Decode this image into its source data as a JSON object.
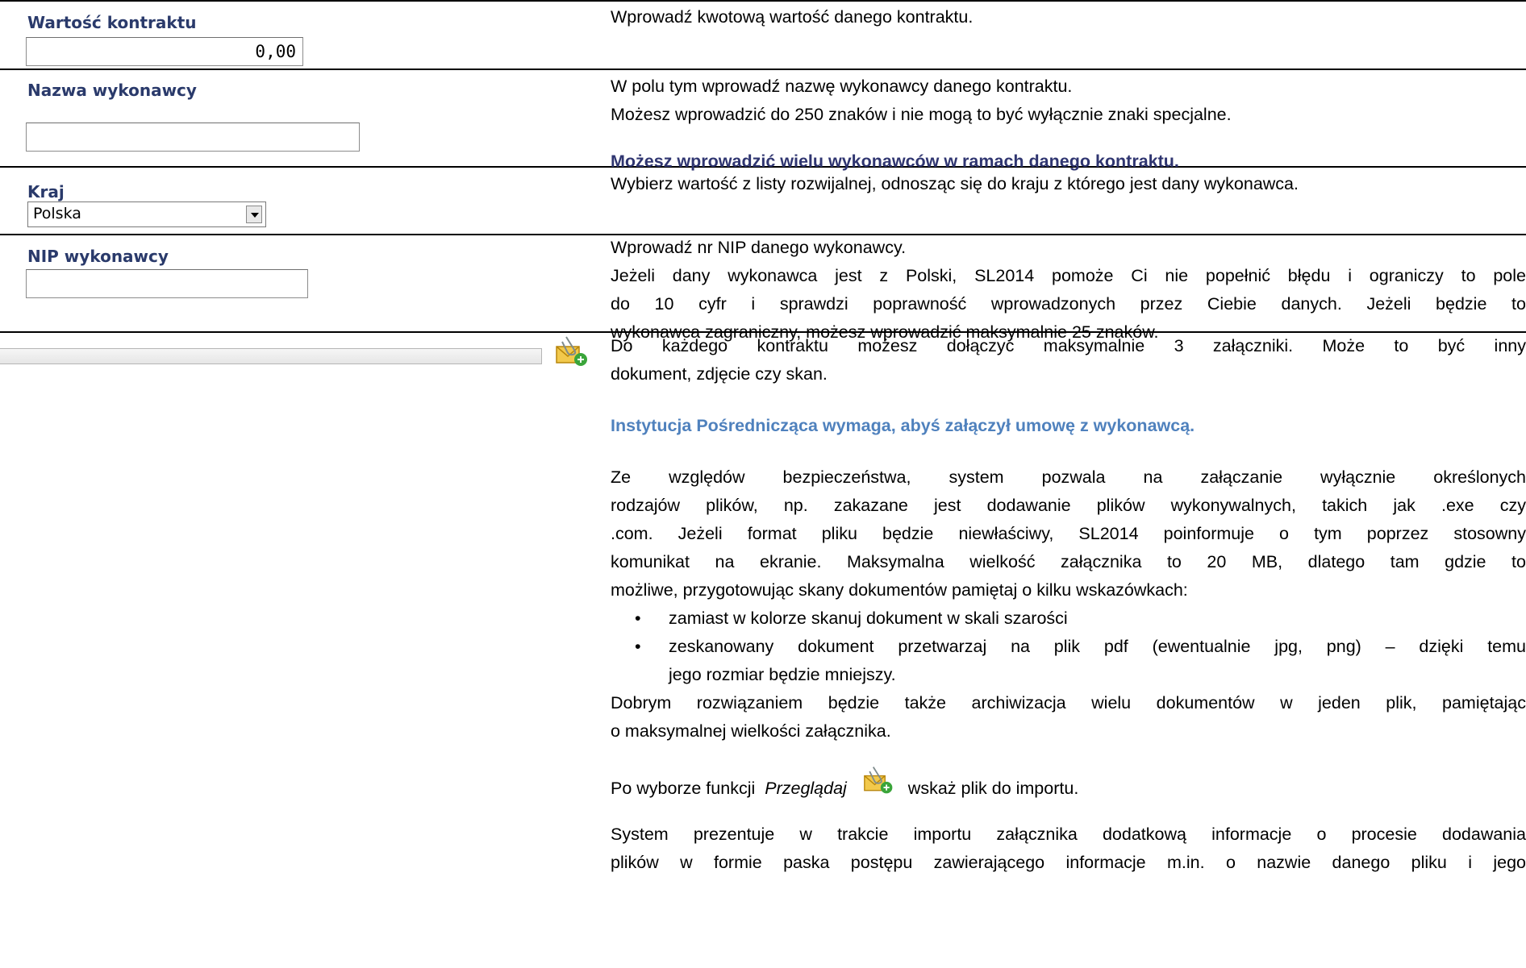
{
  "rows": [
    {
      "label": "Wartość kontraktu",
      "input_value": "0,00",
      "description": [
        "Wprowadź kwotową wartość danego kontraktu."
      ]
    },
    {
      "label": "Nazwa wykonawcy",
      "input_value": "",
      "description": [
        "W polu tym wprowadź nazwę wykonawcy danego kontraktu.",
        "Możesz wprowadzić do 250 znaków i nie mogą to być wyłącznie znaki specjalne.",
        "Możesz wprowadzić wielu wykonawców w ramach danego kontraktu."
      ]
    },
    {
      "label": "Kraj",
      "select_value": "Polska",
      "description": [
        "Wybierz wartość z listy rozwijalnej, odnosząc się do kraju z którego jest dany wykonawca."
      ]
    },
    {
      "label": "NIP wykonawcy",
      "input_value": "",
      "description": [
        "Wprowadź nr NIP danego wykonawcy.",
        "Jeżeli dany wykonawca jest z Polski, SL2014 pomoże Ci nie popełnić błędu i ograniczy to pole",
        "do 10 cyfr i sprawdzi poprawność wprowadzonych przez Ciebie danych. Jeżeli będzie to",
        "wykonawca zagraniczny, możesz wprowadzić maksymalnie 25 znaków."
      ]
    },
    {
      "attachment_icon": "attach-add-icon",
      "description": [
        "Do każdego kontraktu możesz dołączyć maksymalnie 3 załączniki. Może to być inny",
        "dokument, zdjęcie czy skan.",
        "Instytucja Pośrednicząca wymaga, abyś załączył umowę z wykonawcą.",
        "Ze względów bezpieczeństwa, system pozwala na  załączanie wyłącznie określonych",
        "rodzajów plików, np. zakazane jest dodawanie plików wykonywalnych, takich jak .exe czy",
        ".com. Jeżeli format pliku będzie niewłaściwy, SL2014 poinformuje o tym poprzez stosowny",
        "komunikat na ekranie. Maksymalna wielkość załącznika to 20 MB, dlatego tam gdzie to",
        "możliwe, przygotowując skany dokumentów pamiętaj o kilku wskazówkach:",
        "zamiast w kolorze skanuj dokument w skali szarości",
        "zeskanowany dokument przetwarzaj na plik pdf (ewentualnie jpg, png) – dzięki temu",
        "jego rozmiar będzie mniejszy.",
        "Dobrym rozwiązaniem będzie także archiwizacja wielu dokumentów w jeden plik, pamiętając",
        "o maksymalnej wielkości załącznika.",
        "Po wyborze funkcji",
        "Przeglądaj",
        "wskaż plik do importu.",
        "System prezentuje w trakcie importu załącznika dodatkową informacje o procesie dodawania",
        "plików w formie paska postępu zawierającego informacje m.in. o nazwie danego pliku i jego"
      ]
    }
  ],
  "colors": {
    "label": "#2a3a6b",
    "emphasis_dark": "#2f3570",
    "emphasis_light": "#4f81bd"
  }
}
